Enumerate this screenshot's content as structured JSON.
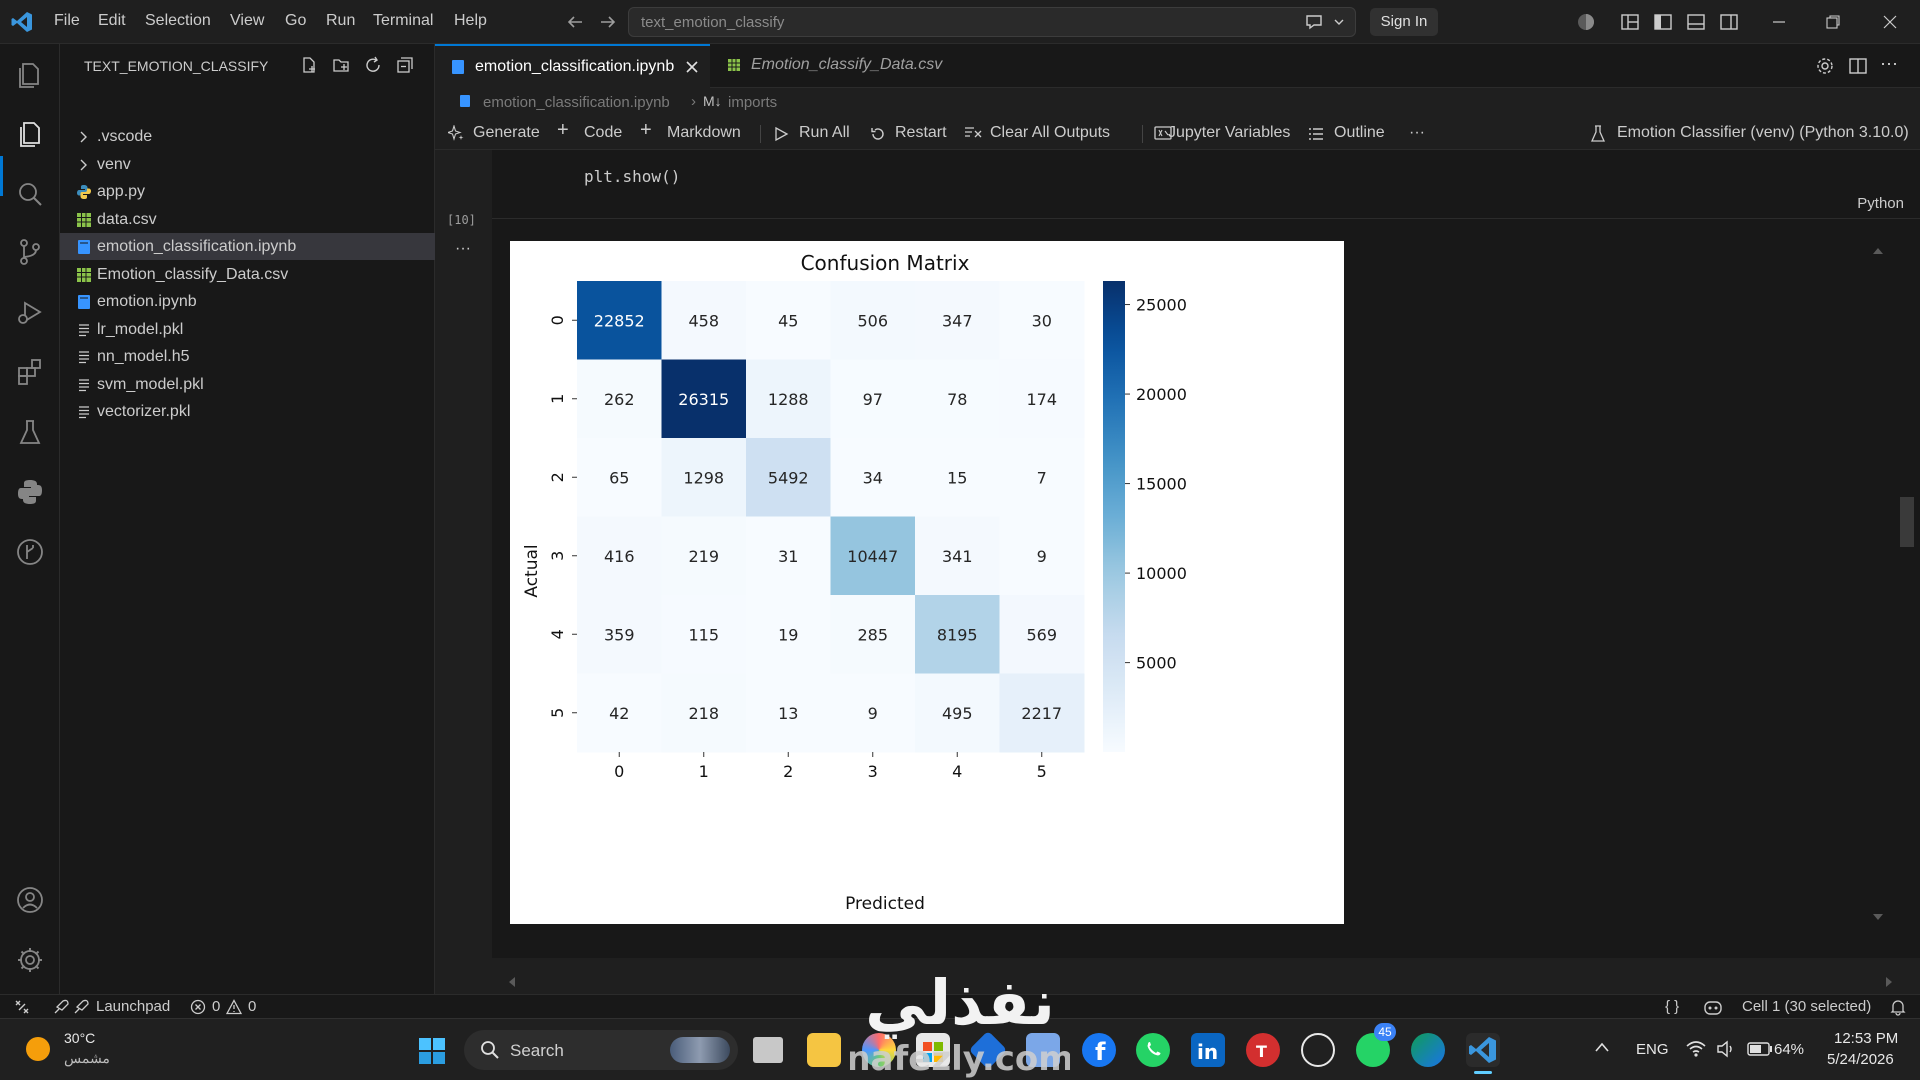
{
  "menu": [
    "File",
    "Edit",
    "Selection",
    "View",
    "Go",
    "Run",
    "Terminal",
    "Help"
  ],
  "command_center": {
    "text": "text_emotion_classify"
  },
  "signin_label": "Sign In",
  "sidebar": {
    "title": "TEXT_EMOTION_CLASSIFY",
    "items": [
      {
        "label": ".vscode",
        "type": "folder"
      },
      {
        "label": "venv",
        "type": "folder"
      },
      {
        "label": "app.py",
        "type": "python"
      },
      {
        "label": "data.csv",
        "type": "csv"
      },
      {
        "label": "emotion_classification.ipynb",
        "type": "notebook",
        "selected": true
      },
      {
        "label": "Emotion_classify_Data.csv",
        "type": "csv"
      },
      {
        "label": "emotion.ipynb",
        "type": "notebook"
      },
      {
        "label": "lr_model.pkl",
        "type": "file"
      },
      {
        "label": "nn_model.h5",
        "type": "file"
      },
      {
        "label": "svm_model.pkl",
        "type": "file"
      },
      {
        "label": "vectorizer.pkl",
        "type": "file"
      }
    ]
  },
  "tabs": [
    {
      "label": "emotion_classification.ipynb",
      "active": true
    },
    {
      "label": "Emotion_classify_Data.csv",
      "active": false
    }
  ],
  "breadcrumb": {
    "file": "emotion_classification.ipynb",
    "section_badge": "M↓",
    "section": "imports"
  },
  "toolbar": {
    "generate": "Generate",
    "code": "Code",
    "markdown": "Markdown",
    "run_all": "Run All",
    "restart": "Restart",
    "clear_outputs": "Clear All Outputs",
    "variables": "Jupyter Variables",
    "outline": "Outline",
    "more": "···",
    "kernel": "Emotion Classifier (venv) (Python 3.10.0)"
  },
  "cell": {
    "code": "plt.show()",
    "exec_count": "[10]",
    "language": "Python",
    "output_dots": "···"
  },
  "chart_data": {
    "type": "heatmap",
    "title": "Confusion Matrix",
    "xlabel": "Predicted",
    "ylabel": "Actual",
    "x_categories": [
      "0",
      "1",
      "2",
      "3",
      "4",
      "5"
    ],
    "y_categories": [
      "0",
      "1",
      "2",
      "3",
      "4",
      "5"
    ],
    "values": [
      [
        22852,
        458,
        45,
        506,
        347,
        30
      ],
      [
        262,
        26315,
        1288,
        97,
        78,
        174
      ],
      [
        65,
        1298,
        5492,
        34,
        15,
        7
      ],
      [
        416,
        219,
        31,
        10447,
        341,
        9
      ],
      [
        359,
        115,
        19,
        285,
        8195,
        569
      ],
      [
        42,
        218,
        13,
        9,
        495,
        2217
      ]
    ],
    "colormap": "Blues",
    "colorbar_ticks": [
      5000,
      10000,
      15000,
      20000,
      25000
    ],
    "colorbar_labels": [
      "5000",
      "10000",
      "15000",
      "20000",
      "25000"
    ],
    "vmin": 7,
    "vmax": 26315
  },
  "statusbar": {
    "launchpad": "Launchpad",
    "errors": "0",
    "warnings": "0",
    "braces": "{ }",
    "cell_status": "Cell 1 (30 selected)"
  },
  "taskbar": {
    "weather_temp": "30°C",
    "weather_desc": "مشمس",
    "search": "Search",
    "badge": "45",
    "lang": "ENG",
    "battery": "64%",
    "time": "12:53 PM",
    "date": "5/24/2026"
  },
  "watermark": {
    "arabic": "نفذلي",
    "latin": "nafezly.com"
  },
  "colors": {
    "accent": "#0078d4",
    "csv": "#8bc34a",
    "notebook": "#3794ff"
  }
}
